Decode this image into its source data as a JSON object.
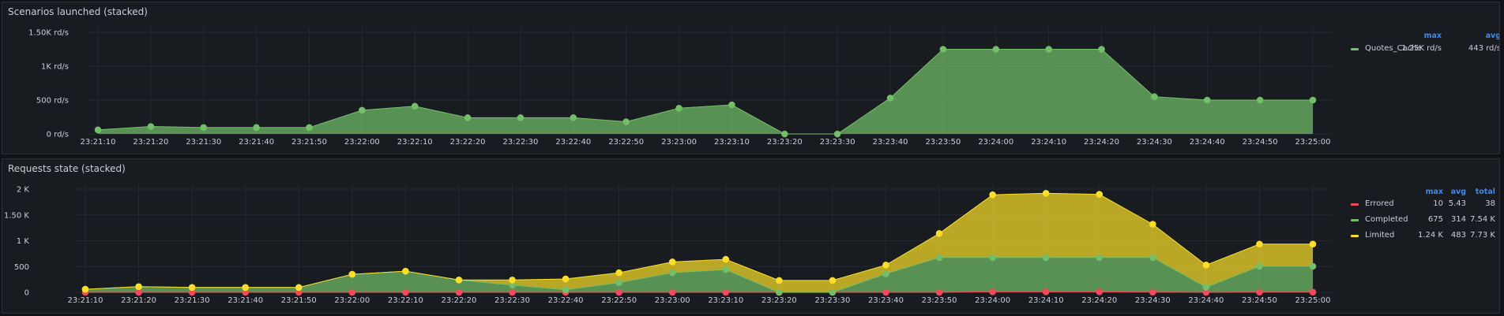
{
  "panels": [
    {
      "title": "Scenarios launched (stacked)",
      "chart_data": {
        "type": "area",
        "stacked": true,
        "x": [
          "23:21:10",
          "23:21:20",
          "23:21:30",
          "23:21:40",
          "23:21:50",
          "23:22:00",
          "23:22:10",
          "23:22:20",
          "23:22:30",
          "23:22:40",
          "23:22:50",
          "23:23:00",
          "23:23:10",
          "23:23:20",
          "23:23:30",
          "23:23:40",
          "23:23:50",
          "23:24:00",
          "23:24:10",
          "23:24:20",
          "23:24:30",
          "23:24:40",
          "23:24:50",
          "23:25:00"
        ],
        "y_ticks": [
          "0 rd/s",
          "500 rd/s",
          "1K rd/s",
          "1.50K rd/s"
        ],
        "ylim": [
          0,
          1500
        ],
        "series": [
          {
            "name": "Quotes_Cache",
            "color": "#73bf69",
            "values": [
              60,
              110,
              95,
              95,
              95,
              350,
              410,
              240,
              240,
              240,
              180,
              380,
              430,
              0,
              0,
              530,
              1250,
              1250,
              1250,
              1250,
              550,
              500,
              500,
              500
            ]
          }
        ],
        "legend_headers": [
          "max",
          "avg"
        ],
        "legend_values": [
          [
            "1.25K rd/s",
            "443 rd/s"
          ]
        ],
        "grid": true,
        "legend_placement": "right"
      }
    },
    {
      "title": "Requests state (stacked)",
      "chart_data": {
        "type": "area",
        "stacked": true,
        "x": [
          "23:21:10",
          "23:21:20",
          "23:21:30",
          "23:21:40",
          "23:21:50",
          "23:22:00",
          "23:22:10",
          "23:22:20",
          "23:22:30",
          "23:22:40",
          "23:22:50",
          "23:23:00",
          "23:23:10",
          "23:23:20",
          "23:23:30",
          "23:23:40",
          "23:23:50",
          "23:24:00",
          "23:24:10",
          "23:24:20",
          "23:24:30",
          "23:24:40",
          "23:24:50",
          "23:25:00"
        ],
        "y_ticks": [
          "0",
          "500",
          "1 K",
          "1.50 K",
          "2 K"
        ],
        "ylim": [
          0,
          2000
        ],
        "series": [
          {
            "name": "Errored",
            "color": "#f2495c",
            "values": [
              0,
              0,
              0,
              0,
              0,
              0,
              0,
              0,
              0,
              0,
              0,
              0,
              0,
              0,
              0,
              0,
              0,
              10,
              10,
              10,
              5,
              0,
              5,
              5
            ]
          },
          {
            "name": "Completed",
            "color": "#73bf69",
            "values": [
              60,
              110,
              95,
              95,
              95,
              350,
              410,
              240,
              140,
              50,
              190,
              380,
              440,
              0,
              0,
              360,
              675,
              665,
              665,
              665,
              670,
              100,
              500,
              500
            ]
          },
          {
            "name": "Limited",
            "color": "#fade2a",
            "values": [
              0,
              0,
              0,
              0,
              0,
              0,
              0,
              0,
              100,
              210,
              190,
              210,
              200,
              230,
              230,
              170,
              465,
              1215,
              1245,
              1225,
              645,
              430,
              430,
              430
            ]
          }
        ],
        "legend_headers": [
          "max",
          "avg",
          "total"
        ],
        "legend_values": [
          [
            "10",
            "5.43",
            "38"
          ],
          [
            "675",
            "314",
            "7.54 K"
          ],
          [
            "1.24 K",
            "483",
            "7.73 K"
          ]
        ],
        "grid": true,
        "legend_placement": "right"
      }
    }
  ]
}
